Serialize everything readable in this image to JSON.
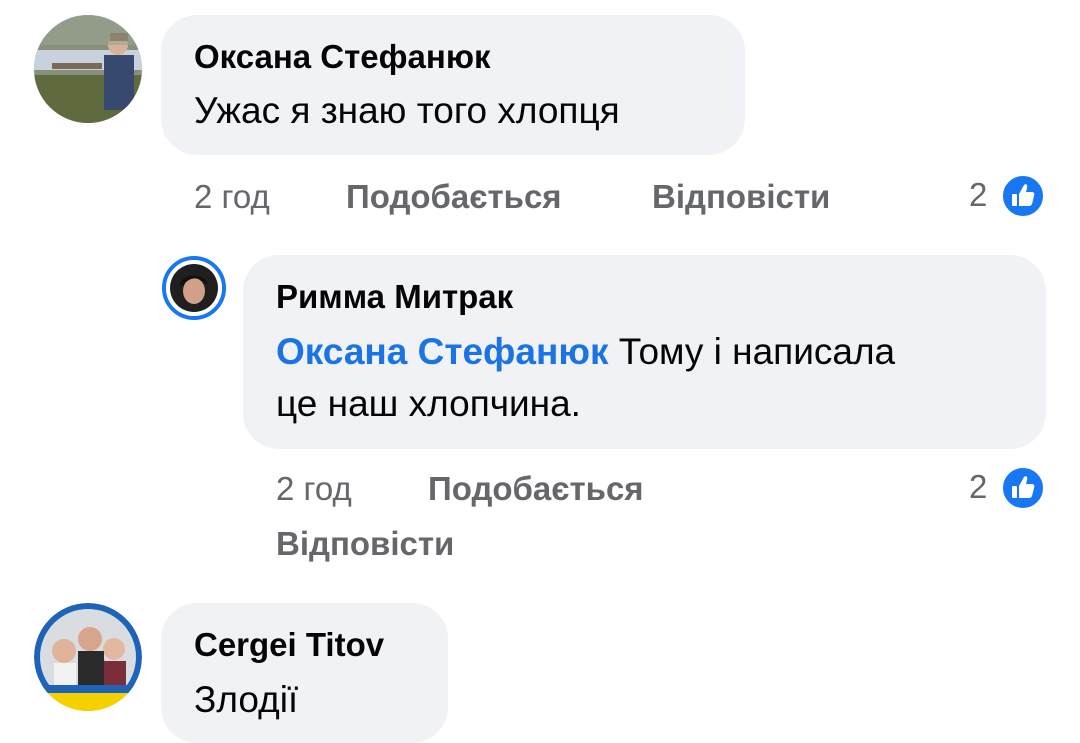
{
  "comments": [
    {
      "author": "Оксана Стефанюк",
      "text": "Ужас я знаю того хлопця",
      "time": "2 год",
      "like_label": "Подобається",
      "reply_label": "Відповісти",
      "reaction_count": "2",
      "reaction_icon": "like-icon"
    },
    {
      "author": "Римма Митрак",
      "mention": "Оксана Стефанюк",
      "text_line1": "Тому і написала",
      "text_line2": "це наш хлопчина.",
      "time": "2 год",
      "like_label": "Подобається",
      "reply_label": "Відповісти",
      "reaction_count": "2",
      "reaction_icon": "like-icon"
    },
    {
      "author": "Cergei Titov",
      "text": "Злодії"
    }
  ],
  "colors": {
    "bubble": "#f0f2f5",
    "link": "#1b74e4",
    "meta": "#65676b",
    "like_badge": "#1877f2"
  }
}
